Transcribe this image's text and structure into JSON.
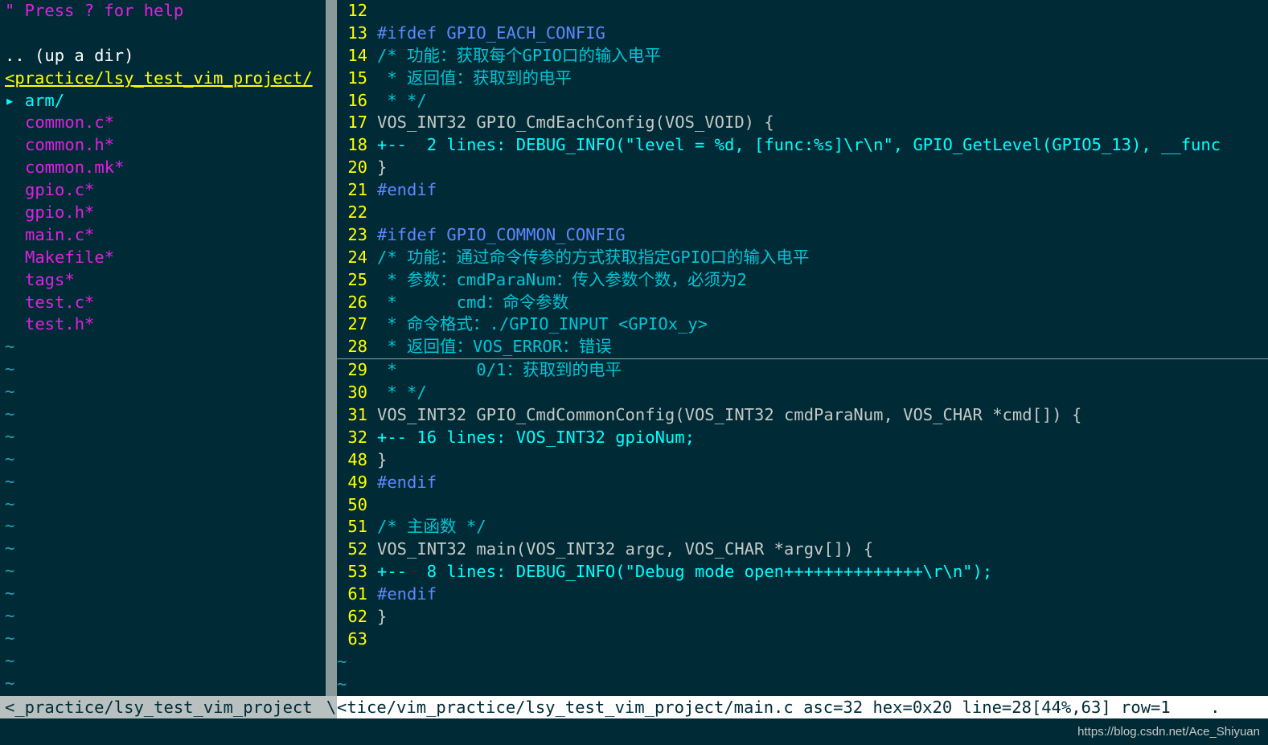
{
  "netrw": {
    "help": "\" Press ? for help",
    "blank": "",
    "updir": ".. (up a dir)",
    "curdir": "<practice/lsy_test_vim_project/",
    "dir_arrow": "▸",
    "dirs": [
      "arm/"
    ],
    "files": [
      "common.c*",
      "common.h*",
      "common.mk*",
      "gpio.c*",
      "gpio.h*",
      "main.c*",
      "Makefile*",
      "tags*",
      "test.c*",
      "test.h*"
    ],
    "tilde": "~"
  },
  "editor": {
    "lines": [
      {
        "n": "12",
        "text": "",
        "cls": "c-normal"
      },
      {
        "n": "13",
        "text": "#ifdef GPIO_EACH_CONFIG",
        "cls": "c-pre"
      },
      {
        "n": "14",
        "text": "/* 功能：获取每个GPIO口的输入电平",
        "cls": "c-comment"
      },
      {
        "n": "15",
        "text": " * 返回值：获取到的电平",
        "cls": "c-comment"
      },
      {
        "n": "16",
        "text": " * */",
        "cls": "c-comment"
      },
      {
        "n": "17",
        "text": "VOS_INT32 GPIO_CmdEachConfig(VOS_VOID) {",
        "cls": "c-normal"
      },
      {
        "n": "18",
        "text": "+--  2 lines: DEBUG_INFO(\"level = %d, [func:%s]\\r\\n\", GPIO_GetLevel(GPIO5_13), __func",
        "cls": "c-fold"
      },
      {
        "n": "20",
        "text": "}",
        "cls": "c-normal"
      },
      {
        "n": "21",
        "text": "#endif",
        "cls": "c-pre"
      },
      {
        "n": "22",
        "text": "",
        "cls": "c-normal"
      },
      {
        "n": "23",
        "text": "#ifdef GPIO_COMMON_CONFIG",
        "cls": "c-pre"
      },
      {
        "n": "24",
        "text": "/* 功能：通过命令传参的方式获取指定GPIO口的输入电平",
        "cls": "c-comment"
      },
      {
        "n": "25",
        "text": " * 参数：cmdParaNum：传入参数个数，必须为2",
        "cls": "c-comment"
      },
      {
        "n": "26",
        "text": " *      cmd：命令参数",
        "cls": "c-comment"
      },
      {
        "n": "27",
        "text": " * 命令格式：./GPIO_INPUT <GPIOx_y>",
        "cls": "c-comment"
      },
      {
        "n": "28",
        "text": " * 返回值：VOS_ERROR：错误",
        "cls": "c-comment",
        "cursor": true
      },
      {
        "n": "29",
        "text": " *        0/1：获取到的电平",
        "cls": "c-comment"
      },
      {
        "n": "30",
        "text": " * */",
        "cls": "c-comment"
      },
      {
        "n": "31",
        "text": "VOS_INT32 GPIO_CmdCommonConfig(VOS_INT32 cmdParaNum, VOS_CHAR *cmd[]) {",
        "cls": "c-normal"
      },
      {
        "n": "32",
        "text": "+-- 16 lines: VOS_INT32 gpioNum;",
        "cls": "c-fold"
      },
      {
        "n": "48",
        "text": "}",
        "cls": "c-normal"
      },
      {
        "n": "49",
        "text": "#endif",
        "cls": "c-pre"
      },
      {
        "n": "50",
        "text": "",
        "cls": "c-normal"
      },
      {
        "n": "51",
        "text": "/* 主函数 */",
        "cls": "c-comment"
      },
      {
        "n": "52",
        "text": "VOS_INT32 main(VOS_INT32 argc, VOS_CHAR *argv[]) {",
        "cls": "c-normal"
      },
      {
        "n": "53",
        "text": "+--  8 lines: DEBUG_INFO(\"Debug mode open++++++++++++++\\r\\n\");",
        "cls": "c-fold"
      },
      {
        "n": "61",
        "text": "#endif",
        "cls": "c-pre"
      },
      {
        "n": "62",
        "text": "}",
        "cls": "c-normal"
      },
      {
        "n": "63",
        "text": "",
        "cls": "c-normal"
      }
    ],
    "tilde": "~"
  },
  "status": {
    "left": "<_practice/lsy_test_vim_project",
    "divider": "\\",
    "right": "<tice/vim_practice/lsy_test_vim_project/main.c asc=32 hex=0x20 line=28[44%,63] row=1    ."
  },
  "watermark": "https://blog.csdn.net/Ace_Shiyuan"
}
